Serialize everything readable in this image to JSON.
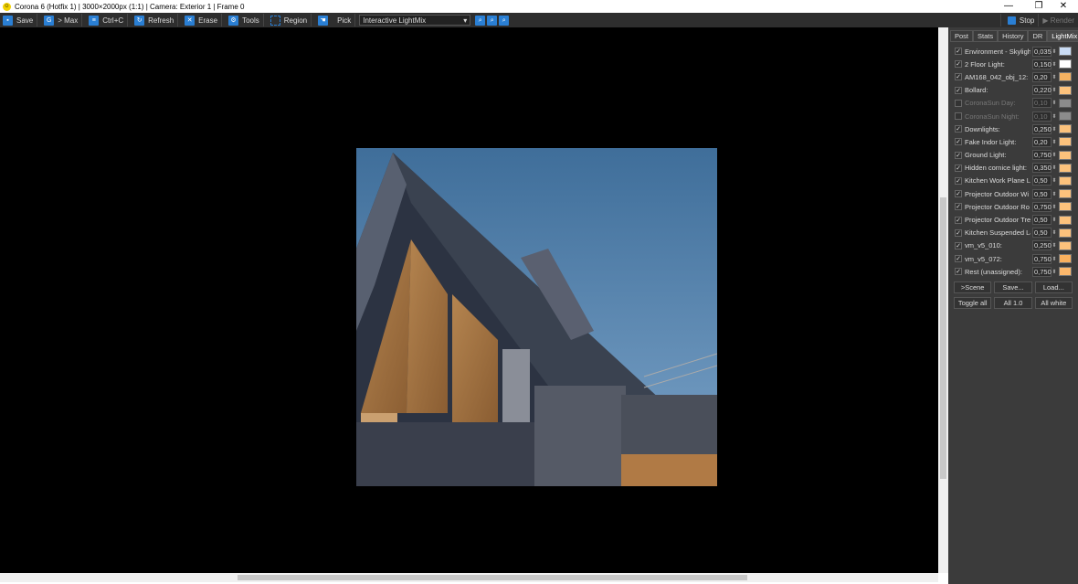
{
  "title": "Corona 6 (Hotfix 1) | 3000×2000px (1:1) | Camera: Exterior 1 | Frame 0",
  "window_controls": {
    "minimize": "—",
    "maximize": "❐",
    "close": "✕"
  },
  "toolbar": {
    "save": "Save",
    "max": "> Max",
    "copy": "Ctrl+C",
    "refresh": "Refresh",
    "erase": "Erase",
    "tools": "Tools",
    "region": "Region",
    "pick": "Pick",
    "mode": "Interactive LightMix"
  },
  "panel": {
    "stop": "Stop",
    "render": "Render",
    "tabs": [
      "Post",
      "Stats",
      "History",
      "DR",
      "LightMix"
    ],
    "lights": [
      {
        "name": "Environment - Skylight",
        "value": "0,035",
        "checked": true,
        "color": "#c9dcf5"
      },
      {
        "name": "2 Floor Light:",
        "value": "0,150",
        "checked": true,
        "color": "#ffffff"
      },
      {
        "name": "AM168_042_obj_12:",
        "value": "0,20",
        "checked": true,
        "color": "#f5b261"
      },
      {
        "name": "Bollard:",
        "value": "0,220",
        "checked": true,
        "color": "#fcc27c"
      },
      {
        "name": "CoronaSun Day:",
        "value": "0,10",
        "checked": false,
        "color": "#dddddd"
      },
      {
        "name": "CoronaSun Night:",
        "value": "0,10",
        "checked": false,
        "color": "#dddddd"
      },
      {
        "name": "Downlights:",
        "value": "0,250",
        "checked": true,
        "color": "#fcc27c"
      },
      {
        "name": "Fake Indor Light:",
        "value": "0,20",
        "checked": true,
        "color": "#fcc27c"
      },
      {
        "name": "Ground Light:",
        "value": "0,750",
        "checked": true,
        "color": "#fcc27c"
      },
      {
        "name": "Hidden cornice light:",
        "value": "0,350",
        "checked": true,
        "color": "#fcc27c"
      },
      {
        "name": "Kitchen Work Plane L",
        "value": "0,50",
        "checked": true,
        "color": "#fcc27c"
      },
      {
        "name": "Projector Outdoor Wi",
        "value": "0,50",
        "checked": true,
        "color": "#fcc27c"
      },
      {
        "name": "Projector Outdoor Ro",
        "value": "0,750",
        "checked": true,
        "color": "#fcc27c"
      },
      {
        "name": "Projector Outdoor Tre",
        "value": "0,50",
        "checked": true,
        "color": "#fcc27c"
      },
      {
        "name": "Kitchen Suspended La",
        "value": "0,50",
        "checked": true,
        "color": "#fcc27c"
      },
      {
        "name": "vm_v5_010:",
        "value": "0,250",
        "checked": true,
        "color": "#fcc27c"
      },
      {
        "name": "vm_v5_072:",
        "value": "0,750",
        "checked": true,
        "color": "#f9b05e"
      },
      {
        "name": "Rest (unassigned):",
        "value": "0,750",
        "checked": true,
        "color": "#fcb86c"
      }
    ],
    "buttons1": [
      ">Scene",
      "Save...",
      "Load..."
    ],
    "buttons2": [
      "Toggle all",
      "All 1.0",
      "All white"
    ]
  }
}
